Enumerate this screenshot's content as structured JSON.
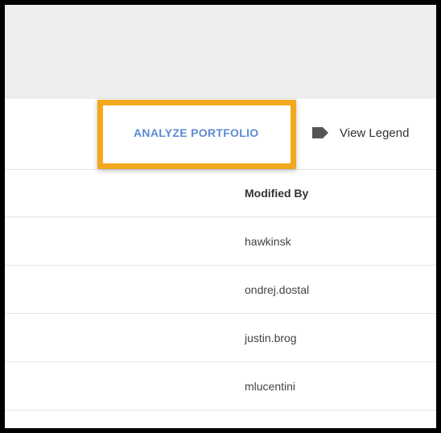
{
  "toolbar": {
    "analyze_label": "ANALYZE PORTFOLIO",
    "legend_label": "View Legend"
  },
  "colors": {
    "accent_link": "#5b8bd6",
    "highlight_border": "#f4a81d",
    "legend_icon": "#555555"
  },
  "icons": {
    "legend": "label-tag-icon"
  },
  "table": {
    "header": "Modified By",
    "rows": [
      {
        "modified_by": "hawkinsk"
      },
      {
        "modified_by": "ondrej.dostal"
      },
      {
        "modified_by": "justin.brog"
      },
      {
        "modified_by": "mlucentini"
      }
    ]
  }
}
